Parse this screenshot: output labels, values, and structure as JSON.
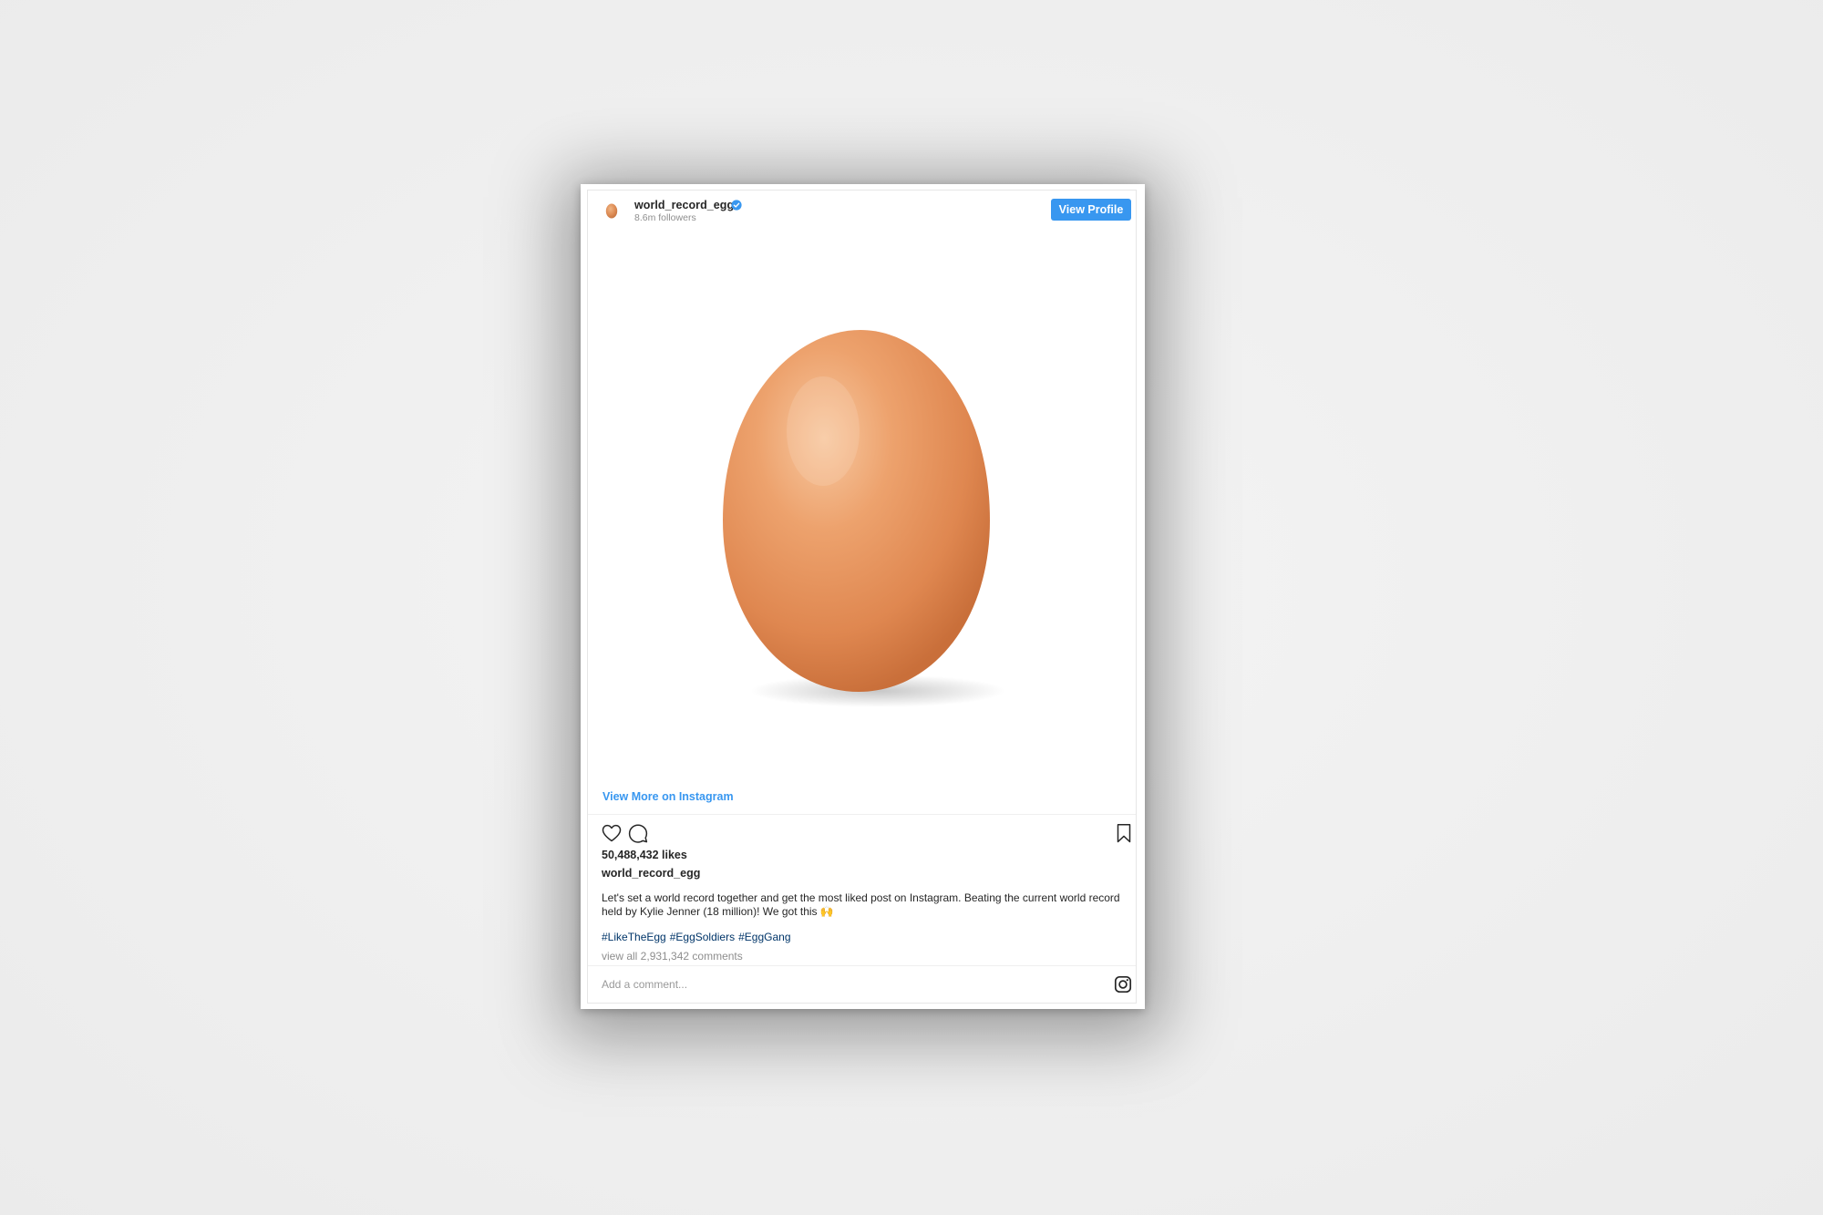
{
  "post": {
    "username": "world_record_egg",
    "verified": true,
    "followers": "8.6m followers",
    "view_profile_label": "View Profile",
    "view_more_label": "View More on Instagram",
    "likes": "50,488,432 likes",
    "caption_user": "world_record_egg",
    "caption": "Let's set a world record together and get the most liked post on Instagram. Beating the current world record held by Kylie Jenner (18 million)! We got this 🙌",
    "hashtags": [
      "#LikeTheEgg",
      "#EggSoldiers",
      "#EggGang"
    ],
    "view_comments": "view all 2,931,342 comments",
    "comment_placeholder": "Add a comment..."
  },
  "icons": {
    "avatar": "egg-avatar",
    "verified": "verified-badge-icon",
    "like": "heart-icon",
    "comment": "comment-bubble-icon",
    "save": "bookmark-icon",
    "brand": "instagram-icon"
  },
  "colors": {
    "background": "#efefef",
    "accent_blue": "#3897f0",
    "hashtag": "#003569",
    "text": "#262626",
    "muted": "#8e8e8e",
    "egg": "#e89a62"
  }
}
